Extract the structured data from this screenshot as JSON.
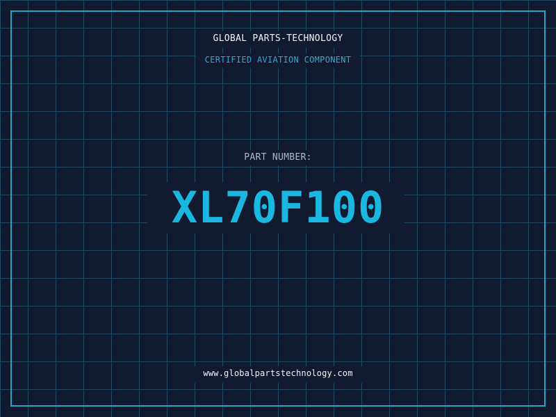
{
  "header": {
    "company": "GLOBAL PARTS-TECHNOLOGY",
    "subtitle": "CERTIFIED AVIATION COMPONENT"
  },
  "part": {
    "label": "PART NUMBER:",
    "number": "XL70F100"
  },
  "footer": {
    "website": "www.globalpartstechnology.com"
  },
  "colors": {
    "background": "#111a2f",
    "grid": "#1c4c63",
    "frame": "#2ba3c7",
    "accent": "#1ab8e0",
    "subtitle": "#39a6d0",
    "text": "#f2f5f8",
    "muted_text": "#aeb7c4"
  }
}
